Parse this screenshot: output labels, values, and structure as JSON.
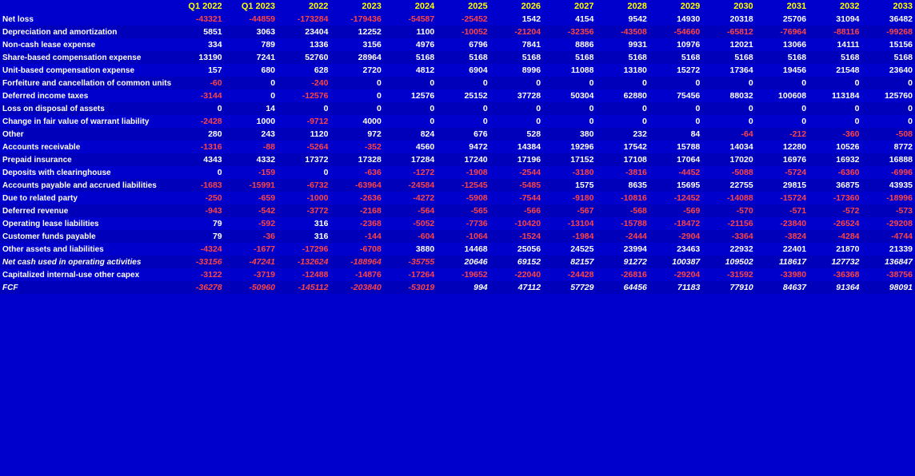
{
  "table": {
    "headers": [
      "",
      "Q1 2022",
      "Q1 2023",
      "2022",
      "2023",
      "2024",
      "2025",
      "2026",
      "2027",
      "2028",
      "2029",
      "2030",
      "2031",
      "2032",
      "2033"
    ],
    "rows": [
      {
        "label": "Net loss",
        "values": [
          "-43321",
          "-44859",
          "-173284",
          "-179436",
          "-54587",
          "-25452",
          "1542",
          "4154",
          "9542",
          "14930",
          "20318",
          "25706",
          "31094",
          "36482"
        ]
      },
      {
        "label": "Depreciation and amortization",
        "values": [
          "5851",
          "3063",
          "23404",
          "12252",
          "1100",
          "-10052",
          "-21204",
          "-32356",
          "-43508",
          "-54660",
          "-65812",
          "-76964",
          "-88116",
          "-99268"
        ]
      },
      {
        "label": "Non-cash lease expense",
        "values": [
          "334",
          "789",
          "1336",
          "3156",
          "4976",
          "6796",
          "7841",
          "8886",
          "9931",
          "10976",
          "12021",
          "13066",
          "14111",
          "15156"
        ]
      },
      {
        "label": "Share-based compensation expense",
        "values": [
          "13190",
          "7241",
          "52760",
          "28964",
          "5168",
          "5168",
          "5168",
          "5168",
          "5168",
          "5168",
          "5168",
          "5168",
          "5168",
          "5168"
        ]
      },
      {
        "label": "Unit-based compensation expense",
        "values": [
          "157",
          "680",
          "628",
          "2720",
          "4812",
          "6904",
          "8996",
          "11088",
          "13180",
          "15272",
          "17364",
          "19456",
          "21548",
          "23640"
        ]
      },
      {
        "label": "Forfeiture and cancellation of common units",
        "values": [
          "-60",
          "0",
          "-240",
          "0",
          "0",
          "0",
          "0",
          "0",
          "0",
          "0",
          "0",
          "0",
          "0",
          "0"
        ]
      },
      {
        "label": "Deferred income taxes",
        "values": [
          "-3144",
          "0",
          "-12576",
          "0",
          "12576",
          "25152",
          "37728",
          "50304",
          "62880",
          "75456",
          "88032",
          "100608",
          "113184",
          "125760"
        ]
      },
      {
        "label": "Loss on disposal of assets",
        "values": [
          "0",
          "14",
          "0",
          "0",
          "0",
          "0",
          "0",
          "0",
          "0",
          "0",
          "0",
          "0",
          "0",
          "0"
        ]
      },
      {
        "label": "Change in fair value of warrant liability",
        "values": [
          "-2428",
          "1000",
          "-9712",
          "4000",
          "0",
          "0",
          "0",
          "0",
          "0",
          "0",
          "0",
          "0",
          "0",
          "0"
        ]
      },
      {
        "label": "Other",
        "values": [
          "280",
          "243",
          "1120",
          "972",
          "824",
          "676",
          "528",
          "380",
          "232",
          "84",
          "-64",
          "-212",
          "-360",
          "-508"
        ]
      },
      {
        "label": "Accounts receivable",
        "values": [
          "-1316",
          "-88",
          "-5264",
          "-352",
          "4560",
          "9472",
          "14384",
          "19296",
          "17542",
          "15788",
          "14034",
          "12280",
          "10526",
          "8772"
        ]
      },
      {
        "label": "Prepaid insurance",
        "values": [
          "4343",
          "4332",
          "17372",
          "17328",
          "17284",
          "17240",
          "17196",
          "17152",
          "17108",
          "17064",
          "17020",
          "16976",
          "16932",
          "16888"
        ]
      },
      {
        "label": "Deposits with clearinghouse",
        "values": [
          "0",
          "-159",
          "0",
          "-636",
          "-1272",
          "-1908",
          "-2544",
          "-3180",
          "-3816",
          "-4452",
          "-5088",
          "-5724",
          "-6360",
          "-6996"
        ]
      },
      {
        "label": "Accounts payable and accrued liabilities",
        "values": [
          "-1683",
          "-15991",
          "-6732",
          "-63964",
          "-24584",
          "-12545",
          "-5485",
          "1575",
          "8635",
          "15695",
          "22755",
          "29815",
          "36875",
          "43935"
        ]
      },
      {
        "label": "Due to related party",
        "values": [
          "-250",
          "-659",
          "-1000",
          "-2636",
          "-4272",
          "-5908",
          "-7544",
          "-9180",
          "-10816",
          "-12452",
          "-14088",
          "-15724",
          "-17360",
          "-18996"
        ]
      },
      {
        "label": "Deferred revenue",
        "values": [
          "-943",
          "-542",
          "-3772",
          "-2168",
          "-564",
          "-565",
          "-566",
          "-567",
          "-568",
          "-569",
          "-570",
          "-571",
          "-572",
          "-573"
        ]
      },
      {
        "label": "Operating lease liabilities",
        "values": [
          "79",
          "-592",
          "316",
          "-2368",
          "-5052",
          "-7736",
          "-10420",
          "-13104",
          "-15788",
          "-18472",
          "-21156",
          "-23840",
          "-26524",
          "-29208"
        ]
      },
      {
        "label": "Customer funds payable",
        "values": [
          "79",
          "-36",
          "316",
          "-144",
          "-604",
          "-1064",
          "-1524",
          "-1984",
          "-2444",
          "-2904",
          "-3364",
          "-3824",
          "-4284",
          "-4744"
        ]
      },
      {
        "label": "Other assets and liabilities",
        "values": [
          "-4324",
          "-1677",
          "-17296",
          "-6708",
          "3880",
          "14468",
          "25056",
          "24525",
          "23994",
          "23463",
          "22932",
          "22401",
          "21870",
          "21339"
        ]
      },
      {
        "label": "Net cash used in operating activities",
        "values": [
          "-33156",
          "-47241",
          "-132624",
          "-188964",
          "-35755",
          "20646",
          "69152",
          "82157",
          "91272",
          "100387",
          "109502",
          "118617",
          "127732",
          "136847"
        ],
        "bold": true
      },
      {
        "label": "Capitalized internal-use other capex",
        "values": [
          "-3122",
          "-3719",
          "-12488",
          "-14876",
          "-17264",
          "-19652",
          "-22040",
          "-24428",
          "-26816",
          "-29204",
          "-31592",
          "-33980",
          "-36368",
          "-38756"
        ]
      },
      {
        "label": "FCF",
        "values": [
          "-36278",
          "-50960",
          "-145112",
          "-203840",
          "-53019",
          "994",
          "47112",
          "57729",
          "64456",
          "71183",
          "77910",
          "84637",
          "91364",
          "98091"
        ],
        "bold": true
      }
    ]
  }
}
